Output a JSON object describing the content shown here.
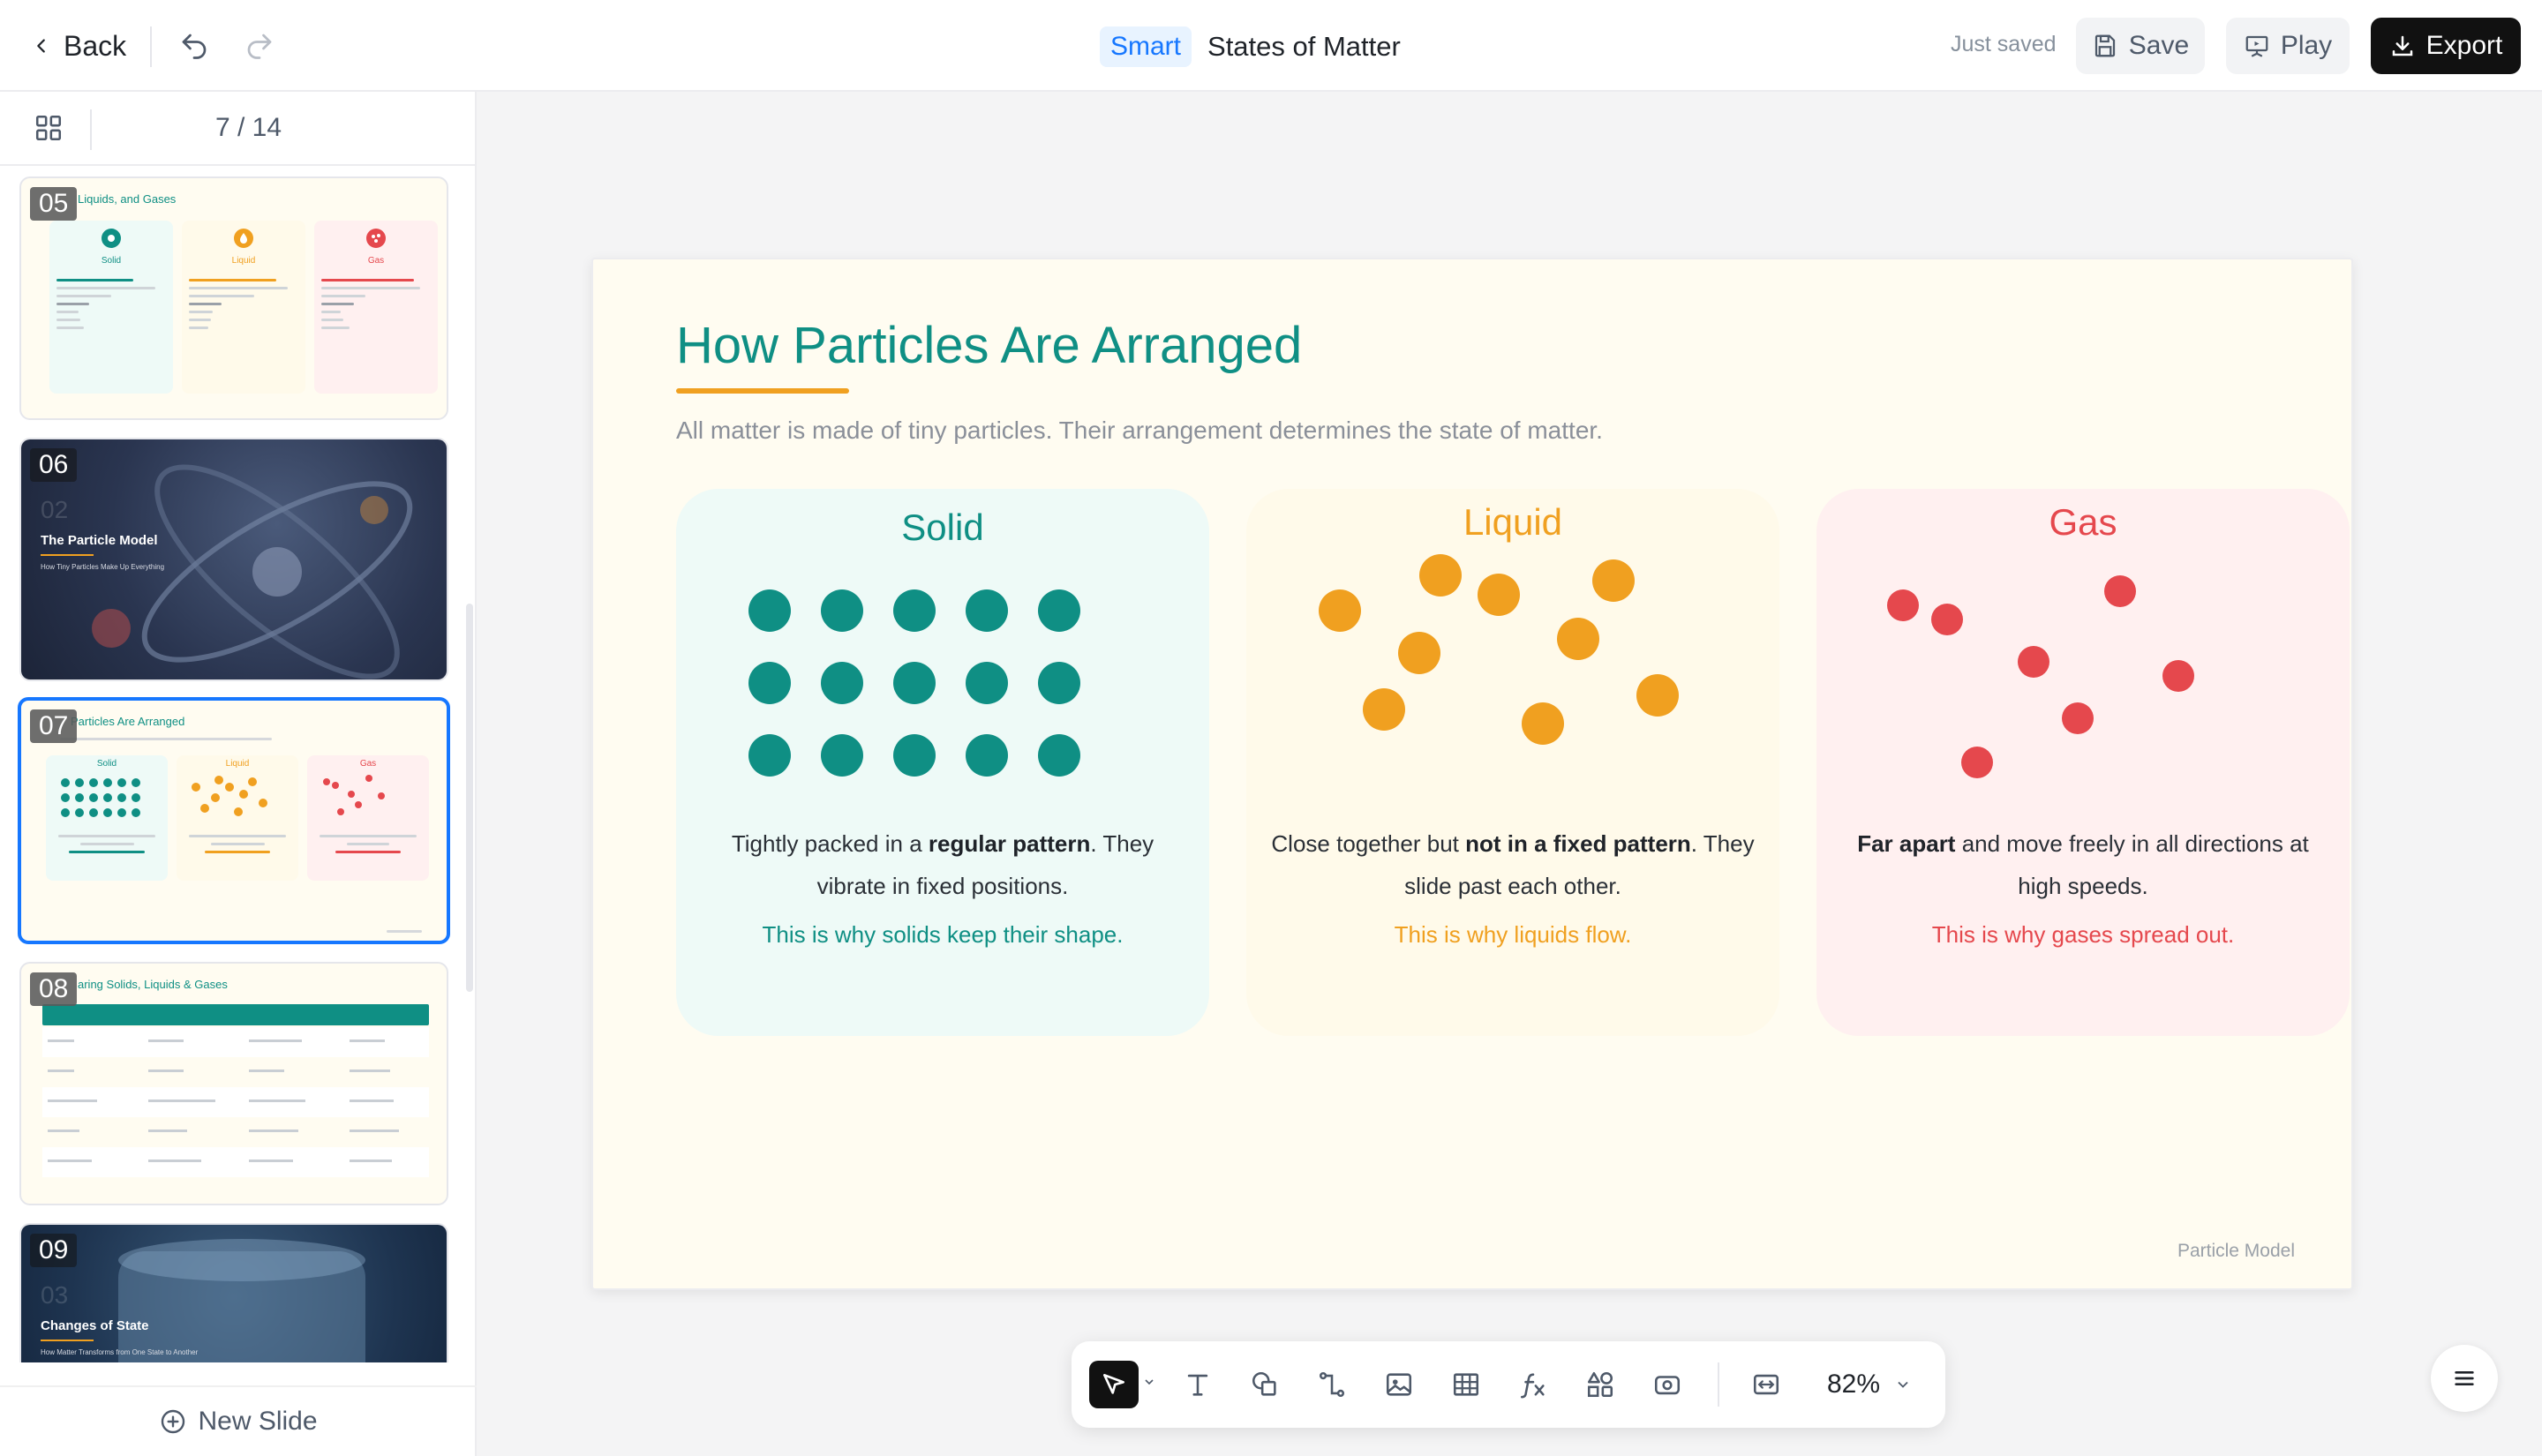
{
  "header": {
    "back_label": "Back",
    "smart_badge": "Smart",
    "doc_title": "States of Matter",
    "save_status": "Just saved",
    "save_label": "Save",
    "play_label": "Play",
    "export_label": "Export"
  },
  "sidebar": {
    "page_indicator": "7 / 14",
    "new_slide_label": "New Slide",
    "thumbnails": [
      {
        "num": "05",
        "title": "Liquids, and Gases",
        "cards": [
          "Solid",
          "Liquid",
          "Gas"
        ]
      },
      {
        "num": "06",
        "section": "02",
        "title": "The Particle Model",
        "subtitle": "How Tiny Particles Make Up Everything"
      },
      {
        "num": "07",
        "title": "Particles Are Arranged",
        "cards": [
          "Solid",
          "Liquid",
          "Gas"
        ]
      },
      {
        "num": "08",
        "title": "aring Solids, Liquids & Gases"
      },
      {
        "num": "09",
        "section": "03",
        "title": "Changes of State",
        "subtitle": "How Matter Transforms from One State to Another"
      }
    ]
  },
  "slide": {
    "title": "How Particles Are Arranged",
    "subtitle": "All matter is made of tiny particles. Their arrangement determines the state of matter.",
    "footer": "Particle Model",
    "cards": [
      {
        "name": "Solid",
        "color": "#0f8f84",
        "bg": "#eefaf7",
        "desc_1": "Tightly packed in a ",
        "desc_b1": "regular pattern",
        "desc_2": ". They vibrate in fixed positions.",
        "conclusion": "This is why solids keep their shape."
      },
      {
        "name": "Liquid",
        "color": "#f0a020",
        "bg": "#fffaea",
        "desc_1": "Close together but ",
        "desc_b1": "not in a fixed pattern",
        "desc_2": ". They slide past each other.",
        "conclusion": "This is why liquids flow."
      },
      {
        "name": "Gas",
        "color": "#e5484d",
        "bg": "#fff0f0",
        "desc_b1": "Far apart",
        "desc_2": " and move freely in all directions at high speeds.",
        "conclusion": "This is why gases spread out."
      }
    ]
  },
  "toolbar": {
    "zoom_label": "82%",
    "tools": [
      "select-tool-icon",
      "text-tool-icon",
      "shape-tool-icon",
      "connector-tool-icon",
      "image-tool-icon",
      "table-tool-icon",
      "formula-tool-icon",
      "components-tool-icon",
      "media-tool-icon",
      "fit-width-icon"
    ]
  }
}
